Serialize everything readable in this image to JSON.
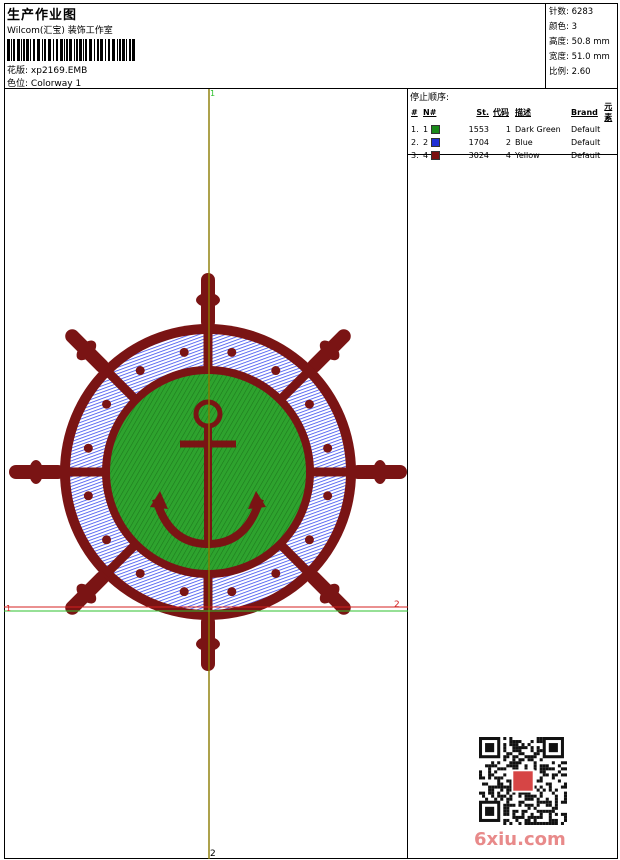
{
  "header": {
    "title": "生产作业图",
    "company": "Wilcom(汇宝) 装饰工作室",
    "design_label": "花版:",
    "design_value": "xp2169.EMB",
    "colorway_label": "色位:",
    "colorway_value": "Colorway 1"
  },
  "stats": [
    {
      "label": "针数:",
      "value": "6283"
    },
    {
      "label": "颜色:",
      "value": "3"
    },
    {
      "label": "高度:",
      "value": "50.8 mm"
    },
    {
      "label": "宽度:",
      "value": "51.0 mm"
    },
    {
      "label": "比例:",
      "value": "2.60"
    }
  ],
  "stop_sequence": {
    "title": "停止顺序:",
    "columns": [
      "#",
      "N#",
      "St.",
      "代码",
      "描述",
      "Brand",
      "元素"
    ],
    "rows": [
      {
        "index": "1.",
        "needle": "1",
        "stitches": "1553",
        "code": "1",
        "description": "Dark Green",
        "brand": "Default",
        "color": "#1a8a1a"
      },
      {
        "index": "2.",
        "needle": "2",
        "stitches": "1704",
        "code": "2",
        "description": "Blue",
        "brand": "Default",
        "color": "#1f2fd6"
      },
      {
        "index": "3.",
        "needle": "4",
        "stitches": "3024",
        "code": "4",
        "description": "Yellow",
        "brand": "Default",
        "color": "#7a1010"
      }
    ]
  },
  "guides": {
    "vertical_top": "1",
    "vertical_bottom": "2",
    "horizontal_left": "1",
    "horizontal_right": "2"
  },
  "colors": {
    "green": "#2ea32e",
    "blue": "#3a4cf0",
    "maroon": "#7a1414",
    "guide_vertical": "#8a7a00",
    "guide_red": "#d42020",
    "guide_green": "#2ec02e"
  },
  "watermark": "6xiu.com"
}
